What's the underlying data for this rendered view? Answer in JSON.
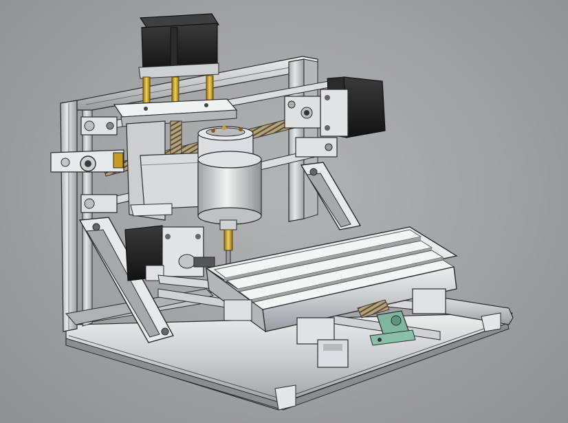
{
  "scene": {
    "subject": "cnc-router-3d-model",
    "colors": {
      "background": "#a3a4a6",
      "aluminum": "#d4d5d7",
      "aluminum_shade": "#9c9da0",
      "edge": "#2a2a2a",
      "motor_black": "#1c1c1c",
      "brass": "#c9a227",
      "spring": "#8a7a60",
      "green_part": "#7fb5a1"
    }
  }
}
